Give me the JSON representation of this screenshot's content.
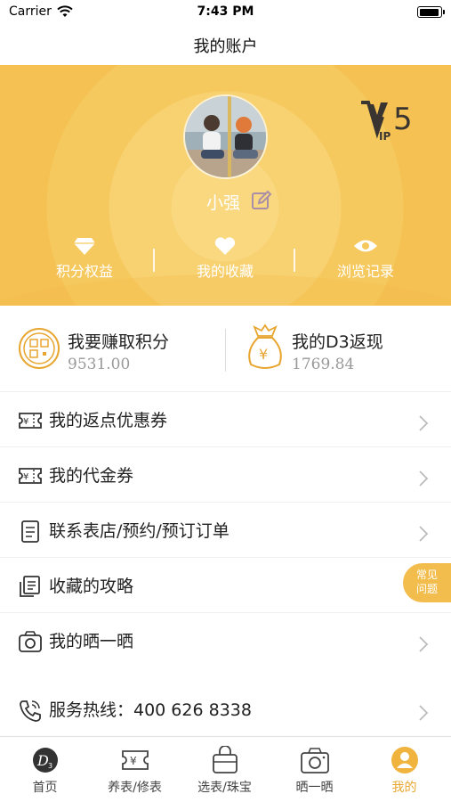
{
  "status_bar": {
    "carrier": "Carrier",
    "time": "7:43 PM"
  },
  "nav": {
    "title": "我的账户"
  },
  "profile": {
    "username": "小强",
    "vip_level": "5",
    "vip_letters": "IP"
  },
  "quick_links": [
    {
      "label": "积分权益",
      "icon": "diamond-icon"
    },
    {
      "label": "我的收藏",
      "icon": "heart-icon"
    },
    {
      "label": "浏览记录",
      "icon": "eye-icon"
    }
  ],
  "points": {
    "earn": {
      "title": "我要赚取积分",
      "value": "9531.00",
      "icon": "points-coin-icon"
    },
    "cashback": {
      "title": "我的D3返现",
      "value": "1769.84",
      "icon": "money-bag-icon"
    }
  },
  "menu": [
    {
      "label": "我的返点优惠券",
      "icon": "coupon-icon",
      "has_arrow": true
    },
    {
      "label": "我的代金券",
      "icon": "voucher-icon",
      "has_arrow": true
    },
    {
      "label": "联系表店/预约/预订订单",
      "icon": "order-list-icon",
      "has_arrow": true
    },
    {
      "label": "收藏的攻略",
      "icon": "guide-book-icon",
      "has_arrow": false
    },
    {
      "label": "我的晒一晒",
      "icon": "camera-icon",
      "has_arrow": true
    },
    {
      "label": "服务热线：400 626 8338",
      "icon": "phone-icon",
      "has_arrow": true
    }
  ],
  "faq": {
    "label_line1": "常见",
    "label_line2": "问题"
  },
  "tabbar": [
    {
      "label": "首页",
      "icon": "d3-home-icon",
      "active": false
    },
    {
      "label": "养表/修表",
      "icon": "watch-care-icon",
      "active": false
    },
    {
      "label": "选表/珠宝",
      "icon": "shopping-bag-icon",
      "active": false
    },
    {
      "label": "晒一晒",
      "icon": "camera-icon",
      "active": false
    },
    {
      "label": "我的",
      "icon": "user-icon",
      "active": true
    }
  ],
  "colors": {
    "brand": "#f4c152",
    "accent": "#e8a630",
    "text": "#222222",
    "muted": "#999999"
  }
}
